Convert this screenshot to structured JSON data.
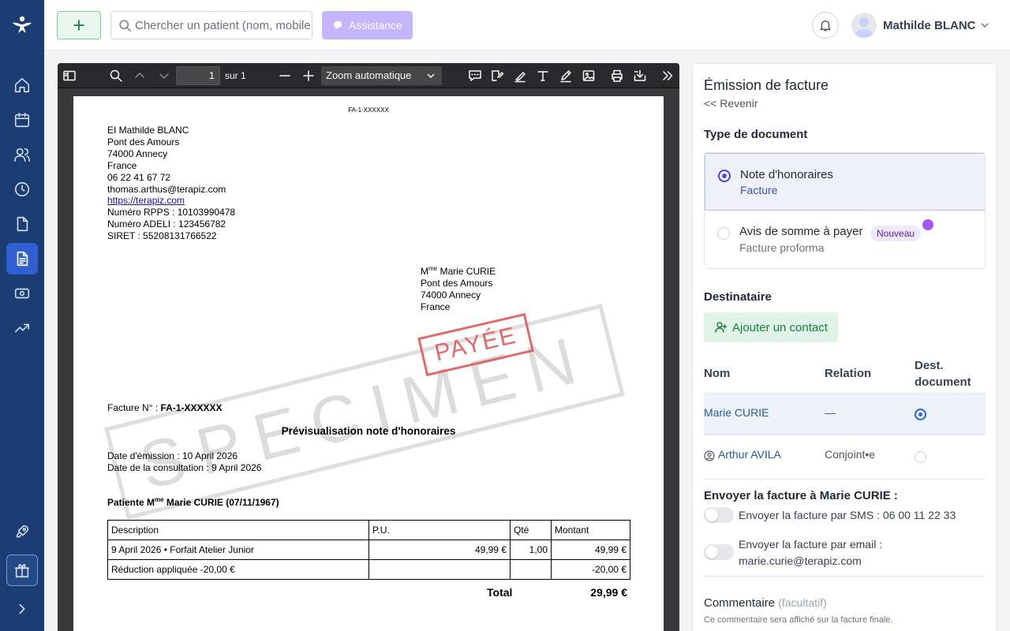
{
  "topbar": {
    "search_placeholder": "Chercher un patient (nom, mobile…)",
    "assist_label": "Assistance",
    "user_name": "Mathilde BLANC"
  },
  "pdf": {
    "page_number": "1",
    "page_of": "sur 1",
    "zoom": "Zoom automatique"
  },
  "document": {
    "ref": "FA-1-XXXXXX",
    "issuer": {
      "name": "EI Mathilde BLANC",
      "street": "Pont des Amours",
      "city": "74000 Annecy",
      "country": "France",
      "phone": "06 22 41 67 72",
      "email": "thomas.arthus@terapiz.com",
      "website": "https://terapiz.com",
      "rpps": "Numéro RPPS : 10103990478",
      "adeli": "Numéro ADELI : 123456782",
      "siret": "SIRET : 55208131766522"
    },
    "recipient": {
      "prefix": "M",
      "prefix_sup": "me",
      "name": " Marie CURIE",
      "street": "Pont des Amours",
      "city": "74000 Annecy",
      "country": "France"
    },
    "stamp_paid": "PAYÉE",
    "stamp_specimen": "SPECIMEN",
    "invoice_label": "Facture N° : ",
    "invoice_number": "FA-1-XXXXXX",
    "preview_title": "Prévisualisation note d'honoraires",
    "emission_date": "Date d'émission : 10 April 2026",
    "consultation_date": "Date de la consultation : 9 April 2026",
    "patient_prefix": "Patiente M",
    "patient_sup": "me",
    "patient_name": " Marie CURIE (07/11/1967)",
    "table": {
      "headers": [
        "Description",
        "P.U.",
        "Qté",
        "Montant"
      ],
      "rows": [
        [
          "9 April 2026 • Forfait Atelier Junior",
          "49,99 €",
          "1,00",
          "49,99 €"
        ],
        [
          "Réduction appliquée -20,00 €",
          "",
          "",
          "-20,00 €"
        ]
      ]
    },
    "total_label": "Total",
    "total_value": "29,99 €"
  },
  "panel": {
    "title": "Émission de facture",
    "back": "<< Revenir",
    "doc_type_heading": "Type de document",
    "options": [
      {
        "label": "Note d'honoraires",
        "sub": "Facture"
      },
      {
        "label": "Avis de somme à payer",
        "sub": "Facture proforma",
        "badge": "Nouveau"
      }
    ],
    "recipient_heading": "Destinataire",
    "add_contact": "Ajouter un contact",
    "columns": [
      "Nom",
      "Relation",
      "Dest. document"
    ],
    "contacts": [
      {
        "name": "Marie CURIE",
        "relation": "—"
      },
      {
        "name": "Arthur AVILA",
        "relation": "Conjoint•e"
      }
    ],
    "send_heading": "Envoyer la facture à Marie CURIE :",
    "sms_label": "Envoyer la facture par SMS : 06 00 11 22 33",
    "email_label": "Envoyer la facture par email : marie.curie@terapiz.com",
    "comment_label": "Commentaire",
    "comment_optional": "(facultatif)",
    "comment_help": "Ce commentaire sera affiché sur la facture finale."
  }
}
